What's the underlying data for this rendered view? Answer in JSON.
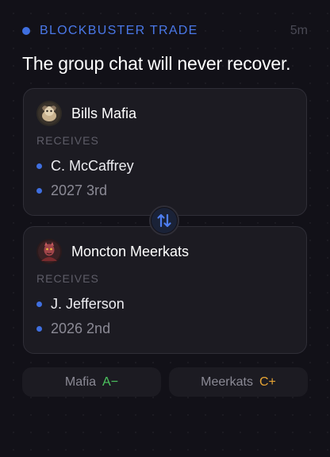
{
  "header": {
    "tag": "BLOCKBUSTER TRADE",
    "time": "5m"
  },
  "headline": "The group chat will never recover.",
  "teams": [
    {
      "name": "Bills Mafia",
      "receives_label": "RECEIVES",
      "assets": [
        "C. McCaffrey",
        "2027 3rd"
      ]
    },
    {
      "name": "Moncton Meerkats",
      "receives_label": "RECEIVES",
      "assets": [
        "J. Jefferson",
        "2026 2nd"
      ]
    }
  ],
  "swap_icon": "swap-vertical-arrows-icon",
  "grades": [
    {
      "team": "Mafia",
      "grade": "A−",
      "color": "#4cc45f"
    },
    {
      "team": "Meerkats",
      "grade": "C+",
      "color": "#e8a534"
    }
  ],
  "colors": {
    "accent": "#3f6fe0",
    "background": "#121118",
    "card": "#1c1b22"
  }
}
